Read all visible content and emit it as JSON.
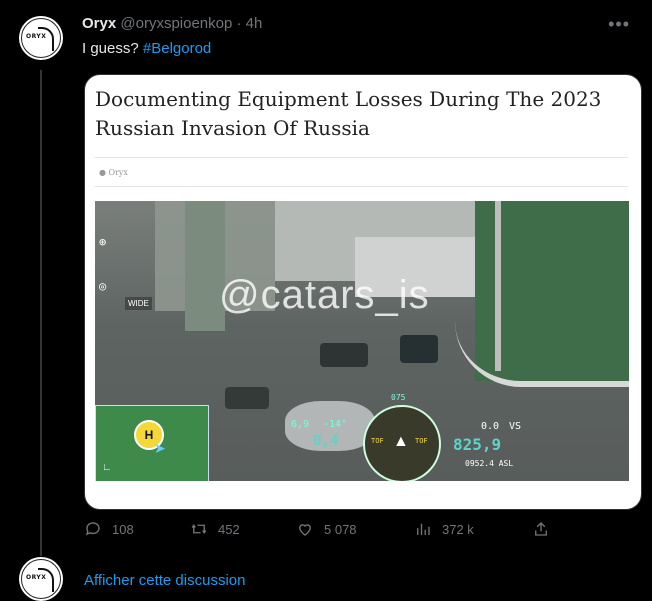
{
  "tweet": {
    "author_name": "Oryx",
    "handle": "@oryxspioenkop",
    "separator": "·",
    "time": "4h",
    "more_label": "•••",
    "text": "I guess? ",
    "hashtag": "#Belgorod",
    "avatar_text": "ORYX"
  },
  "card": {
    "title": "Documenting Equipment Losses During The 2023 Russian Invasion Of Russia",
    "author": "Oryx",
    "photo": {
      "watermark": "@catars_is",
      "wide_label": "WIDE",
      "minimap_pin": "H",
      "hud_left_value": "0,4",
      "hud_right_value": "825,9",
      "hud_small_1": "6,9",
      "hud_small_2": "-14°",
      "hud_small_3": "0.0",
      "hud_small_4": "VS",
      "hud_asl": "0952.4 ASL",
      "compass_top": "075",
      "compass_left": "TOF",
      "compass_right": "TOF"
    }
  },
  "actions": {
    "replies": "108",
    "retweets": "452",
    "likes": "5 078",
    "views": "372 k"
  },
  "show_thread": {
    "label": "Afficher cette discussion",
    "avatar_text": "ORYX"
  },
  "colors": {
    "background": "#000000",
    "link": "#1d9bf0",
    "secondary_text": "#71767b",
    "primary_text": "#e7e9ea"
  }
}
